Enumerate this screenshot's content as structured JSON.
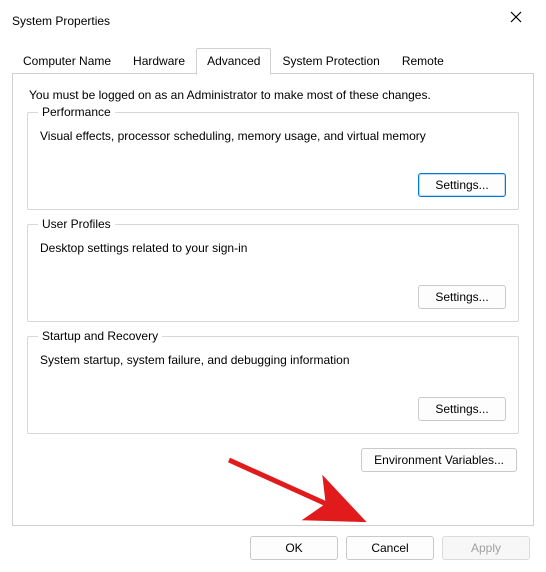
{
  "window": {
    "title": "System Properties"
  },
  "tabs": [
    "Computer Name",
    "Hardware",
    "Advanced",
    "System Protection",
    "Remote"
  ],
  "active_tab_index": 2,
  "admin_notice": "You must be logged on as an Administrator to make most of these changes.",
  "groups": {
    "performance": {
      "legend": "Performance",
      "desc": "Visual effects, processor scheduling, memory usage, and virtual memory",
      "button": "Settings..."
    },
    "userprofiles": {
      "legend": "User Profiles",
      "desc": "Desktop settings related to your sign-in",
      "button": "Settings..."
    },
    "startup": {
      "legend": "Startup and Recovery",
      "desc": "System startup, system failure, and debugging information",
      "button": "Settings..."
    }
  },
  "env_button": "Environment Variables...",
  "footer": {
    "ok": "OK",
    "cancel": "Cancel",
    "apply": "Apply"
  },
  "annotation": {
    "arrow_color": "#e11b1b"
  }
}
